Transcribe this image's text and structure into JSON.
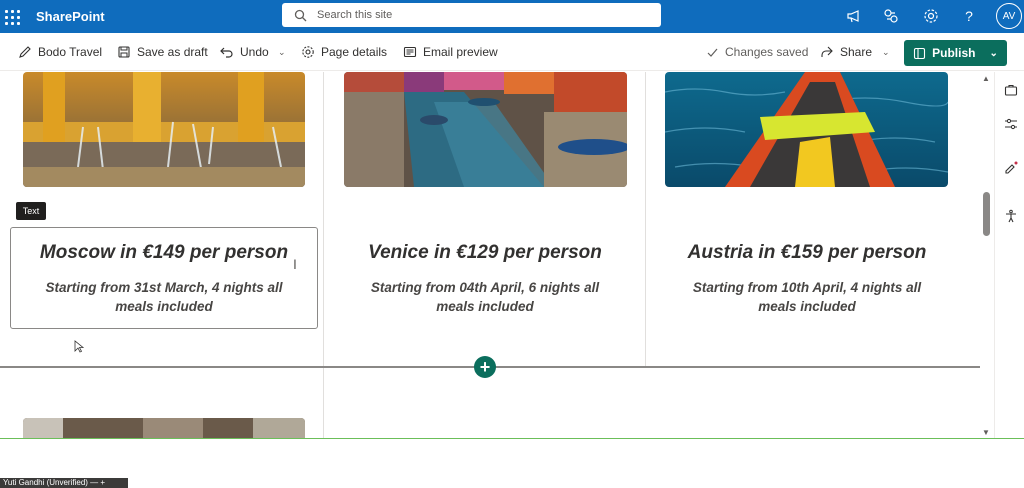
{
  "suite": {
    "app_name": "SharePoint",
    "search_placeholder": "Search this site",
    "avatar_initials": "AV"
  },
  "command_bar": {
    "site_name": "Bodo Travel",
    "save_draft": "Save as draft",
    "undo": "Undo",
    "page_details": "Page details",
    "email_preview": "Email preview",
    "status": "Changes saved",
    "share": "Share",
    "publish": "Publish"
  },
  "tooltip": "Text",
  "cards": [
    {
      "title": "Moscow in €149 per person",
      "subtitle": "Starting from 31st March, 4 nights all meals included"
    },
    {
      "title": "Venice in €129 per person",
      "subtitle": "Starting from 04th April, 6 nights all meals included"
    },
    {
      "title": "Austria in €159 per person",
      "subtitle": "Starting from 10th April, 4 nights all meals included"
    }
  ],
  "participant": "Yuti Gandhi (Unverified)",
  "colors": {
    "suite_bar": "#0f6cbd",
    "publish": "#0b6e5d",
    "accent": "#0b6e5d"
  }
}
